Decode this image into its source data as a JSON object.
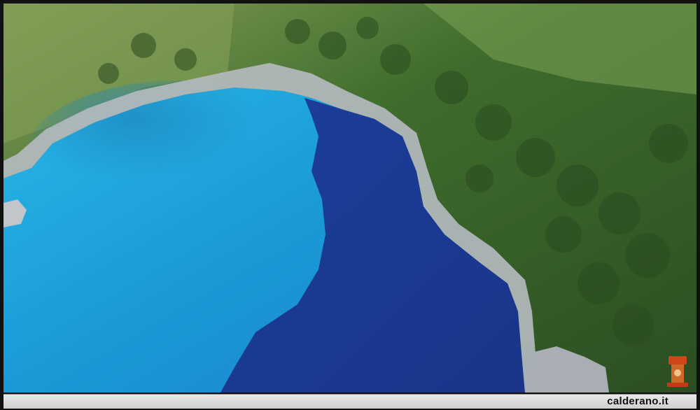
{
  "image": {
    "description_tag": "aerial-coastal-bay-photo"
  },
  "caption": {
    "site_text": "calderano.it"
  },
  "colors": {
    "shallow_water": "#1fa3d8",
    "deep_water": "#1b3f9a",
    "vegetation": "#3d6b2c",
    "rock": "#b9bdc2",
    "caption_bar": "#dcdcdc"
  }
}
